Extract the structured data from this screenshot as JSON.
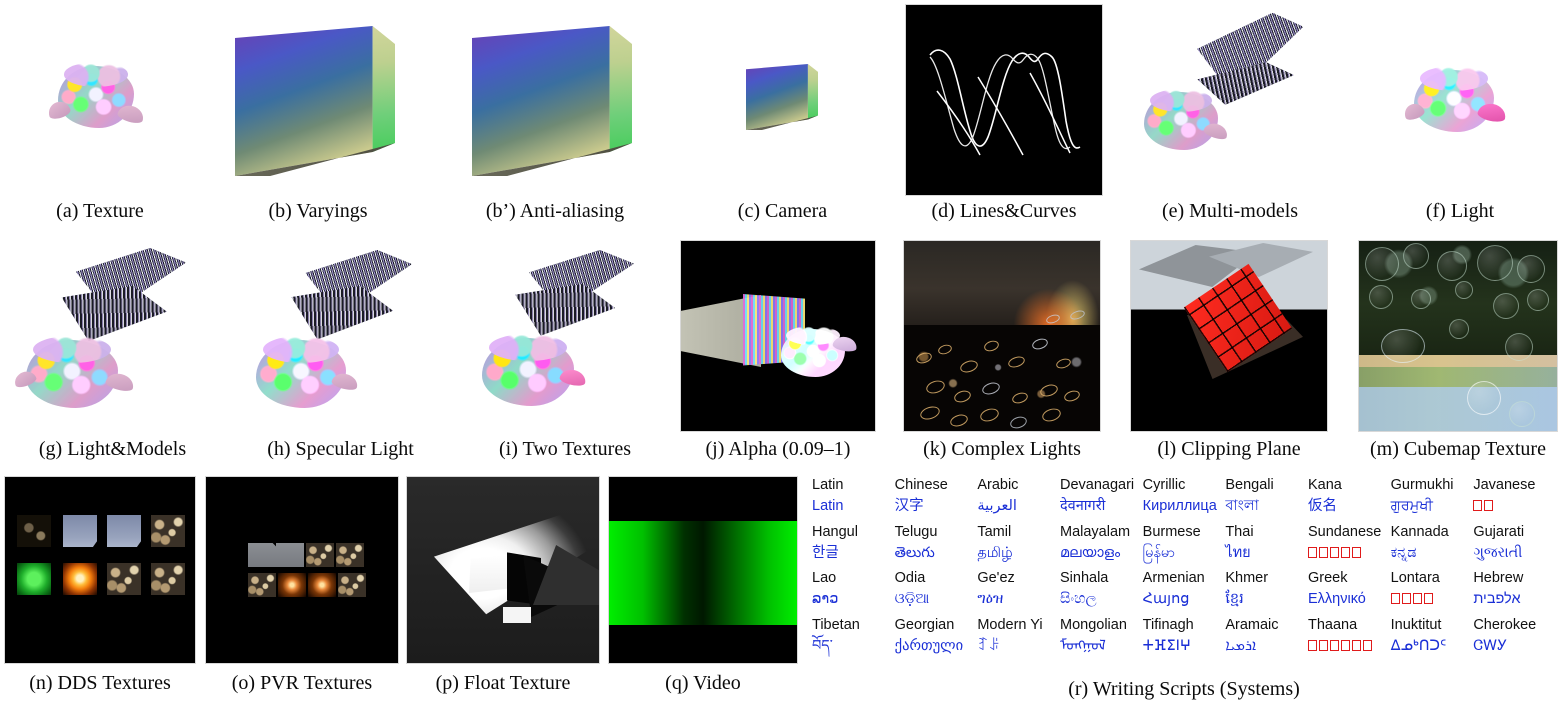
{
  "figure": {
    "title": "Rendering feature gallery",
    "background": "#ffffff",
    "caption_color": "#0a0a0a",
    "accent_blue": "#1a2fd6",
    "tofu_red": "#e01b1b"
  },
  "panels": [
    {
      "id": "a",
      "label": "(a) Texture",
      "kind": "white"
    },
    {
      "id": "b",
      "label": "(b) Varyings",
      "kind": "white"
    },
    {
      "id": "b2",
      "label": "(b') Anti-aliasing",
      "kind": "white"
    },
    {
      "id": "c",
      "label": "(c) Camera",
      "kind": "white"
    },
    {
      "id": "d",
      "label": "(d) Lines&Curves",
      "kind": "black"
    },
    {
      "id": "e",
      "label": "(e) Multi-models",
      "kind": "white"
    },
    {
      "id": "f",
      "label": "(f) Light",
      "kind": "white"
    },
    {
      "id": "g",
      "label": "(g) Light&Models",
      "kind": "white"
    },
    {
      "id": "h",
      "label": "(h) Specular Light",
      "kind": "white"
    },
    {
      "id": "i",
      "label": "(i) Two Textures",
      "kind": "white"
    },
    {
      "id": "j",
      "label": "(j) Alpha (0.09–1)",
      "kind": "black"
    },
    {
      "id": "k",
      "label": "(k) Complex Lights",
      "kind": "black"
    },
    {
      "id": "l",
      "label": "(l) Clipping Plane",
      "kind": "black"
    },
    {
      "id": "m",
      "label": "(m) Cubemap Texture",
      "kind": "photo"
    },
    {
      "id": "n",
      "label": "(n) DDS Textures",
      "kind": "black"
    },
    {
      "id": "o",
      "label": "(o) PVR Textures",
      "kind": "black"
    },
    {
      "id": "p",
      "label": "(p) Float Texture",
      "kind": "gray"
    },
    {
      "id": "q",
      "label": "(q) Video",
      "kind": "black"
    },
    {
      "id": "r",
      "label": "(r) Writing Scripts (Systems)",
      "kind": "table"
    }
  ],
  "captions": {
    "a": "(a) Texture",
    "b": "(b) Varyings",
    "b2": "(b’) Anti-aliasing",
    "c": "(c) Camera",
    "d": "(d) Lines&Curves",
    "e": "(e) Multi-models",
    "f": "(f) Light",
    "g": "(g) Light&Models",
    "h": "(h) Specular Light",
    "i": "(i) Two Textures",
    "j": "(j) Alpha (0.09–1)",
    "k": "(k) Complex Lights",
    "l": "(l) Clipping Plane",
    "m": "(m) Cubemap Texture",
    "n": "(n) DDS Textures",
    "o": "(o) PVR Textures",
    "p": "(p) Float Texture",
    "q": "(q) Video",
    "r": "(r) Writing Scripts (Systems)"
  },
  "scripts": {
    "columns": 9,
    "rows": 4,
    "cells": [
      {
        "name": "Latin",
        "sample": "Latin",
        "missing": false
      },
      {
        "name": "Chinese",
        "sample": "汉字",
        "missing": false
      },
      {
        "name": "Arabic",
        "sample": "العربية",
        "missing": false
      },
      {
        "name": "Devanagari",
        "sample": "देवनागरी",
        "missing": false
      },
      {
        "name": "Cyrillic",
        "sample": "Кириллица",
        "missing": false
      },
      {
        "name": "Bengali",
        "sample": "বাংলা",
        "missing": false
      },
      {
        "name": "Kana",
        "sample": "仮名",
        "missing": false
      },
      {
        "name": "Gurmukhi",
        "sample": "ਗੁਰਮੁਖੀ",
        "missing": false
      },
      {
        "name": "Javanese",
        "sample": "",
        "missing": true,
        "missing_count": 2
      },
      {
        "name": "Hangul",
        "sample": "한글",
        "missing": false
      },
      {
        "name": "Telugu",
        "sample": "తెలుగు",
        "missing": false
      },
      {
        "name": "Tamil",
        "sample": "தமிழ்",
        "missing": false
      },
      {
        "name": "Malayalam",
        "sample": "മലയാളം",
        "missing": false
      },
      {
        "name": "Burmese",
        "sample": "မြန်မာ",
        "missing": false
      },
      {
        "name": "Thai",
        "sample": "ไทย",
        "missing": false
      },
      {
        "name": "Sundanese",
        "sample": "",
        "missing": true,
        "missing_count": 5
      },
      {
        "name": "Kannada",
        "sample": "ಕನ್ನಡ",
        "missing": false
      },
      {
        "name": "Gujarati",
        "sample": "ગુજરાતી",
        "missing": false
      },
      {
        "name": "Lao",
        "sample": "ລາວ",
        "missing": false
      },
      {
        "name": "Odia",
        "sample": "ଓଡ଼ିଆ",
        "missing": false
      },
      {
        "name": "Ge'ez",
        "sample": "ግዕዝ",
        "missing": false
      },
      {
        "name": "Sinhala",
        "sample": "සිංහල",
        "missing": false
      },
      {
        "name": "Armenian",
        "sample": "Հայոց",
        "missing": false
      },
      {
        "name": "Khmer",
        "sample": "ខ្មែរ",
        "missing": false
      },
      {
        "name": "Greek",
        "sample": "Ελληνικό",
        "missing": false
      },
      {
        "name": "Lontara",
        "sample": "",
        "missing": true,
        "missing_count": 4
      },
      {
        "name": "Hebrew",
        "sample": "אלפבית",
        "missing": false
      },
      {
        "name": "Tibetan",
        "sample": "བོད་",
        "missing": false
      },
      {
        "name": "Georgian",
        "sample": "ქართული",
        "missing": false
      },
      {
        "name": "Modern Yi",
        "sample": "ꆈꌠ",
        "missing": false
      },
      {
        "name": "Mongolian",
        "sample": "ᠮᠣᠩᠭᠣᠯ",
        "missing": false
      },
      {
        "name": "Tifinagh",
        "sample": "ⵜⴼⵉⵏⵖ",
        "missing": false
      },
      {
        "name": "Aramaic",
        "sample": "ܐܪܡܝܐ",
        "missing": false
      },
      {
        "name": "Thaana",
        "sample": "",
        "missing": true,
        "missing_count": 6
      },
      {
        "name": "Inuktitut",
        "sample": "ᐃᓄᒃᑎᑐᑦ",
        "missing": false
      },
      {
        "name": "Cherokee",
        "sample": "ᏣᎳᎩ",
        "missing": false
      }
    ]
  }
}
